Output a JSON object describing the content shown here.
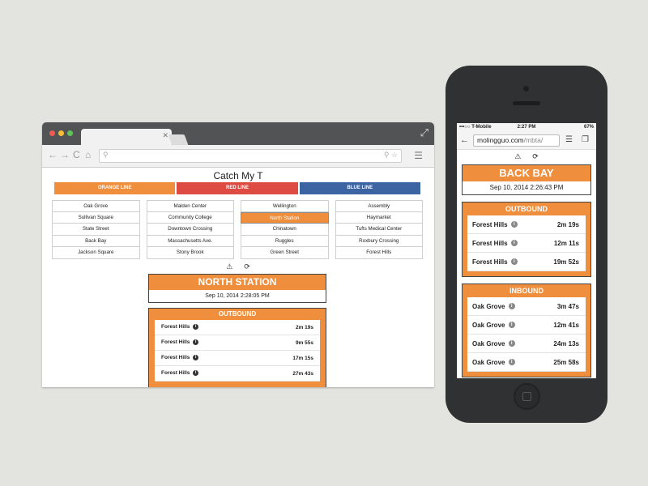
{
  "desktop": {
    "app_title": "Catch My T",
    "lines": [
      {
        "label": "ORANGE LINE",
        "color": "#ef8e3d"
      },
      {
        "label": "RED LINE",
        "color": "#de4b43"
      },
      {
        "label": "BLUE LINE",
        "color": "#3c63a2"
      }
    ],
    "station_columns": [
      [
        "Oak Grove",
        "Sullivan Square",
        "State Street",
        "Back Bay",
        "Jackson Square"
      ],
      [
        "Malden Center",
        "Community College",
        "Downtown Crossing",
        "Massachusetts Ave.",
        "Stony Brook"
      ],
      [
        "Wellington",
        "North Station",
        "Chinatown",
        "Ruggles",
        "Green Street"
      ],
      [
        "Assembly",
        "Haymarket",
        "Tufts Medical Center",
        "Roxbury Crossing",
        "Forest Hills"
      ]
    ],
    "selected_station": "North Station",
    "station_name": "NORTH STATION",
    "station_time": "Sep 10, 2014 2:28:05 PM",
    "direction": "OUTBOUND",
    "trips": [
      {
        "dest": "Forest Hills",
        "eta": "2m 19s"
      },
      {
        "dest": "Forest Hills",
        "eta": "9m 55s"
      },
      {
        "dest": "Forest Hills",
        "eta": "17m 15s"
      },
      {
        "dest": "Forest Hills",
        "eta": "27m 43s"
      }
    ]
  },
  "mobile": {
    "carrier": "•••○○ T-Mobile",
    "clock": "2:27 PM",
    "battery": "67%",
    "url_host": "molingguo.com",
    "url_path": "/mbta/",
    "station_name": "BACK BAY",
    "station_time": "Sep 10, 2014 2:26:43 PM",
    "outbound": {
      "label": "OUTBOUND",
      "trips": [
        {
          "dest": "Forest Hills",
          "eta": "2m 19s"
        },
        {
          "dest": "Forest Hills",
          "eta": "12m 11s"
        },
        {
          "dest": "Forest Hills",
          "eta": "19m 52s"
        }
      ]
    },
    "inbound": {
      "label": "INBOUND",
      "trips": [
        {
          "dest": "Oak Grove",
          "eta": "3m 47s"
        },
        {
          "dest": "Oak Grove",
          "eta": "12m 41s"
        },
        {
          "dest": "Oak Grove",
          "eta": "24m 13s"
        },
        {
          "dest": "Oak Grove",
          "eta": "25m 58s"
        }
      ]
    }
  }
}
